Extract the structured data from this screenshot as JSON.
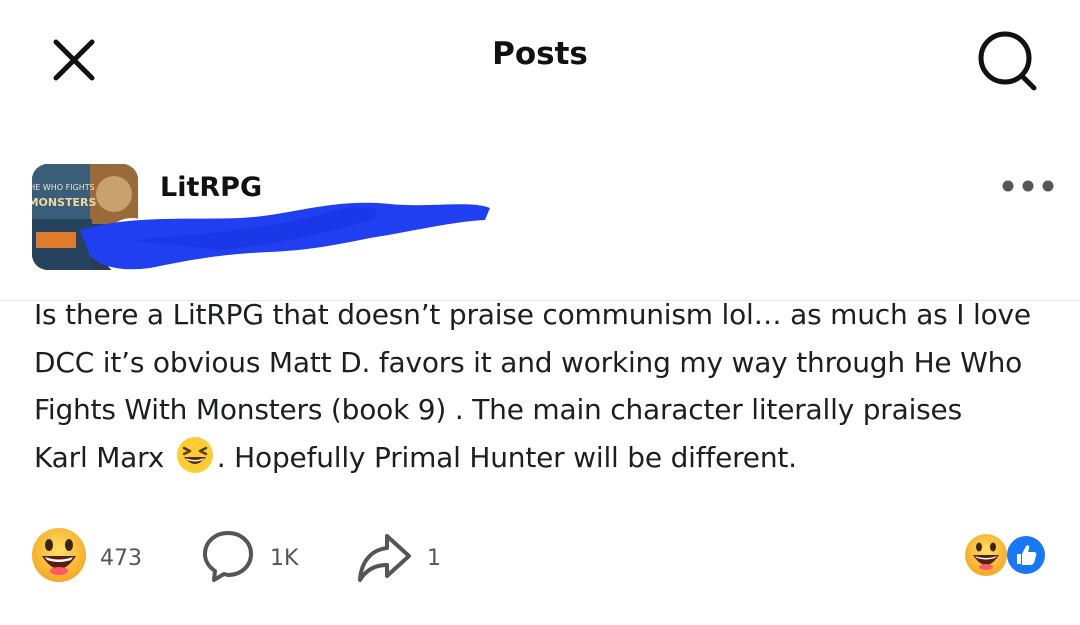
{
  "header": {
    "title": "Posts",
    "close_icon": "close-icon",
    "search_icon": "search-icon"
  },
  "post": {
    "group_name": "LitRPG",
    "avatar_cover_text": "He Who Fights Monsters",
    "text_lines": [
      "Is there a LitRPG that doesn’t praise communism lol… as much as I love",
      "DCC it’s obvious Matt D. favors it and working my way through He Who",
      "Fights With Monsters (book 9) . The main character literally praises"
    ],
    "text_line4_before": "Karl Marx ",
    "text_line4_after": ". Hopefully Primal Hunter will be different.",
    "more_icon": "more-dots-icon"
  },
  "actions": {
    "reaction_count": "473",
    "comment_count": "1K",
    "share_count": "1"
  },
  "colors": {
    "redaction": "#1f3ff0",
    "like_blue": "#1877f2",
    "emoji_yellow": "#ffcc33"
  }
}
